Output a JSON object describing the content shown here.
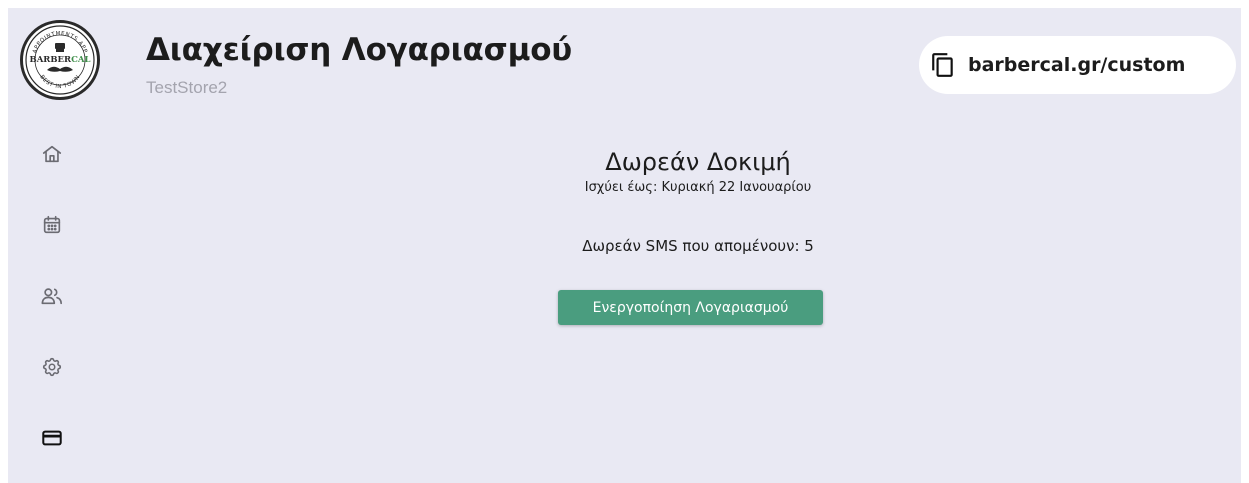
{
  "header": {
    "title": "Διαχείριση Λογαριασμού",
    "store_name": "TestStore2",
    "booking_url": "barbercal.gr/custom",
    "logo": {
      "top_text": "APPOINTMENTS APP",
      "brand_dark": "BARBER",
      "brand_accent": "CAL",
      "bottom_text": "BEST IN TOWN"
    }
  },
  "sidebar": {
    "items": [
      {
        "icon": "home-icon",
        "active": false
      },
      {
        "icon": "calendar-icon",
        "active": false
      },
      {
        "icon": "users-icon",
        "active": false
      },
      {
        "icon": "gear-icon",
        "active": false
      },
      {
        "icon": "credit-card-icon",
        "active": true
      }
    ]
  },
  "account": {
    "plan_title": "Δωρεάν Δοκιμή",
    "valid_until": "Ισχύει έως: Κυριακή 22 Ιανουαρίου",
    "sms_remaining": "Δωρεάν SMS που απομένουν: 5",
    "activate_label": "Ενεργοποίηση Λογαριασμού"
  },
  "colors": {
    "background": "#e9e9f3",
    "button": "#4a9d7f",
    "brand_accent": "#3f8f4a",
    "icon_inactive": "#6b6b72",
    "icon_active": "#111111"
  }
}
